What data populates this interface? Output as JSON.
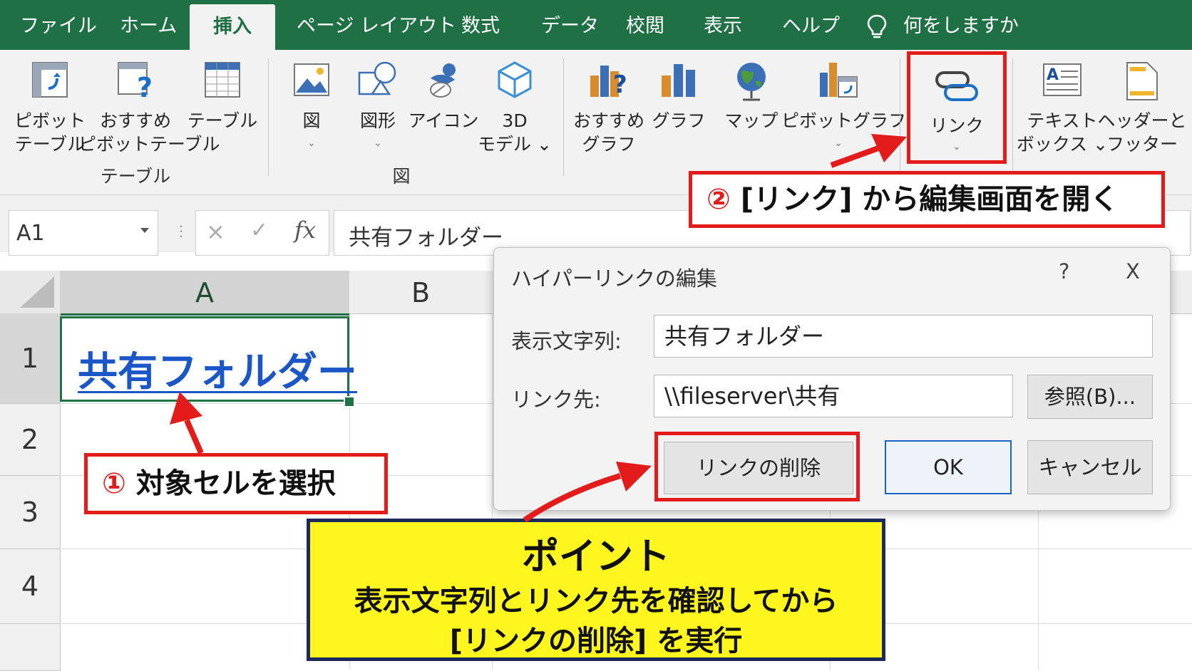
{
  "tabs": [
    "ファイル",
    "ホーム",
    "挿入",
    "ページ レイアウト",
    "数式",
    "データ",
    "校閲",
    "表示",
    "ヘルプ"
  ],
  "active_tab": "挿入",
  "tell_me": "何をしますか",
  "ribbon": {
    "pivot_table": [
      "ピボット",
      "テーブル"
    ],
    "recommended_pivot": [
      "おすすめ",
      "ピボットテーブル"
    ],
    "table": "テーブル",
    "group_table": "テーブル",
    "picture": "図",
    "shapes": "図形",
    "icons": "アイコン",
    "model3d": [
      "3D",
      "モデル"
    ],
    "group_illustration": "図",
    "recommended_charts": [
      "おすすめ",
      "グラフ"
    ],
    "charts": "グラフ",
    "maps": "マップ",
    "pivot_chart": "ピボットグラフ",
    "link": "リンク",
    "textbox": [
      "テキスト",
      "ボックス"
    ],
    "header_footer": [
      "ヘッダーと",
      "フッター"
    ]
  },
  "formula_bar": {
    "name_box": "A1",
    "fx": "fx",
    "cancel": "×",
    "enter": "✓",
    "content": "共有フォルダー"
  },
  "sheet": {
    "columns": [
      "A",
      "B"
    ],
    "rows": [
      "1",
      "2",
      "3",
      "4"
    ],
    "cell_a1": "共有フォルダー"
  },
  "dialog": {
    "title": "ハイパーリンクの編集",
    "help": "?",
    "close": "X",
    "display_text_label": "表示文字列:",
    "display_text_value": "共有フォルダー",
    "address_label": "リンク先:",
    "address_value": "\\\\fileserver\\共有",
    "browse": "参照(B)...",
    "remove_link": "リンクの削除",
    "ok": "OK",
    "cancel": "キャンセル"
  },
  "callouts": {
    "step1_num": "①",
    "step1_text": "対象セルを選択",
    "step2_num": "②",
    "step2_text": "[リンク] から編集画面を開く",
    "point_title": "ポイント",
    "point_line1": "表示文字列とリンク先を確認してから",
    "point_line2": "[リンクの削除] を実行"
  },
  "colors": {
    "excel_green": "#1f7145",
    "callout_red": "#e31b1b",
    "point_yellow": "#fff620",
    "link_blue": "#1a56c8"
  }
}
